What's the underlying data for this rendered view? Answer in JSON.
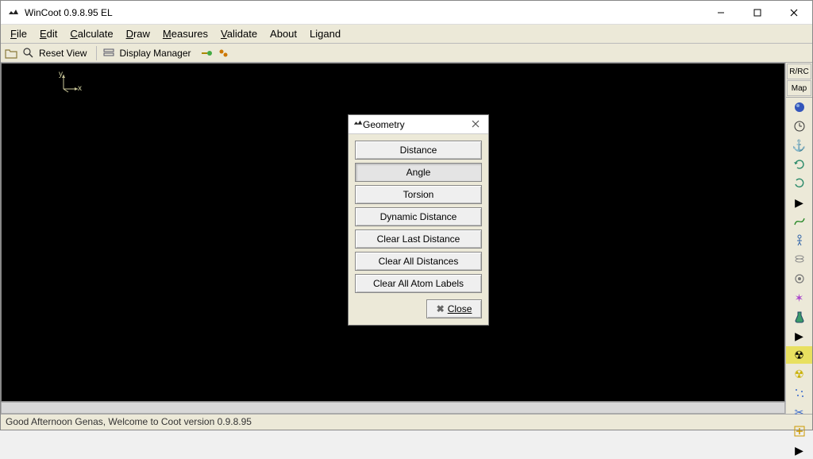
{
  "window": {
    "title": "WinCoot 0.9.8.95 EL"
  },
  "menubar": {
    "file": "File",
    "edit": "Edit",
    "calculate": "Calculate",
    "draw": "Draw",
    "measures": "Measures",
    "validate": "Validate",
    "about": "About",
    "ligand": "Ligand"
  },
  "toolbar": {
    "reset_view": "Reset View",
    "display_manager": "Display Manager"
  },
  "right_panel": {
    "rrc": "R/RC",
    "map": "Map"
  },
  "dialog": {
    "title": "Geometry",
    "buttons": {
      "distance": "Distance",
      "angle": "Angle",
      "torsion": "Torsion",
      "dynamic_distance": "Dynamic Distance",
      "clear_last_distance": "Clear Last Distance",
      "clear_all_distances": "Clear All Distances",
      "clear_all_atom_labels": "Clear All Atom Labels"
    },
    "close": "Close"
  },
  "statusbar": {
    "text": "Good Afternoon Genas, Welcome to Coot version 0.9.8.95"
  },
  "axis": {
    "x": "x",
    "y": "y"
  }
}
